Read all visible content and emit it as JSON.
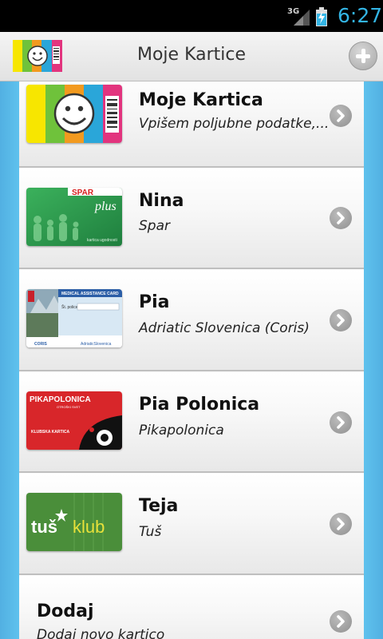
{
  "status_bar": {
    "network": "3G",
    "time": "6:27"
  },
  "action_bar": {
    "title": "Moje Kartice"
  },
  "cards": [
    {
      "title": "Moje Kartica",
      "subtitle": "Vpišem poljubne podatke,..."
    },
    {
      "title": "Nina",
      "subtitle": "Spar"
    },
    {
      "title": "Pia",
      "subtitle": "Adriatic Slovenica (Coris)"
    },
    {
      "title": "Pia Polonica",
      "subtitle": "Pikapolonica"
    },
    {
      "title": "Teja",
      "subtitle": "Tuš"
    }
  ],
  "add_row": {
    "title": "Dodaj",
    "subtitle": "Dodaj novo kartico"
  },
  "card_art": {
    "spar": {
      "brand": "SPAR",
      "sub": "plus",
      "caption": "kartica ugodnosti"
    },
    "coris": {
      "header": "MEDICAL ASSISTANCE CARD",
      "field": "Št. police:",
      "left_logo": "CORIS",
      "right_logo": "AdriaticSlovenica"
    },
    "pikapolonica": {
      "brand": "PIKAPOLONICA",
      "tagline": "OTROŠKI SVET",
      "label": "KLUBSKA KARTICA"
    },
    "tus": {
      "brand": "tuš",
      "club": "klub"
    }
  },
  "colors": {
    "accent": "#33b5e5",
    "background": "#62c6f0",
    "spar_green": "#2e9e4f",
    "pika_red": "#d8262a",
    "tus_green": "#4a8e3a"
  }
}
